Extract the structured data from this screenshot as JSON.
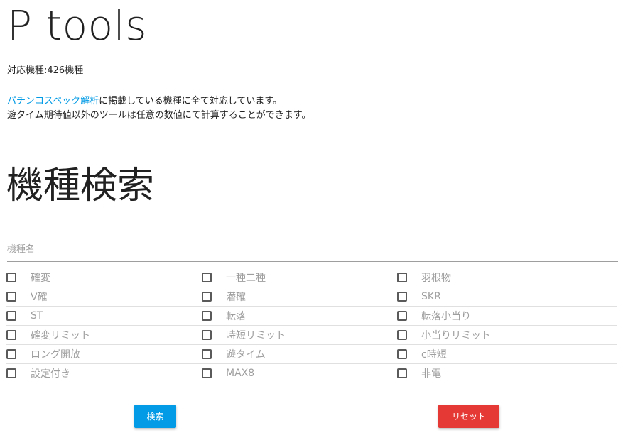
{
  "header": {
    "title": "P tools",
    "count_text": "対応機種:426機種",
    "desc_link": "パチンコスペック解析",
    "desc_line1_rest": "に掲載している機種に全て対応しています。",
    "desc_line2": "遊タイム期待値以外のツールは任意の数値にて計算することができます。"
  },
  "search": {
    "title": "機種検索",
    "field_label": "機種名",
    "field_value": "",
    "search_button": "検索",
    "reset_button": "リセット"
  },
  "filters": [
    [
      "確変",
      "一種二種",
      "羽根物"
    ],
    [
      "V確",
      "潜確",
      "SKR"
    ],
    [
      "ST",
      "転落",
      "転落小当り"
    ],
    [
      "確変リミット",
      "時短リミット",
      "小当りリミット"
    ],
    [
      "ロング開放",
      "遊タイム",
      "c時短"
    ],
    [
      "設定付き",
      "MAX8",
      "非電"
    ]
  ],
  "colors": {
    "link": "#039be5",
    "search_button": "#039be5",
    "reset_button": "#e53935"
  }
}
